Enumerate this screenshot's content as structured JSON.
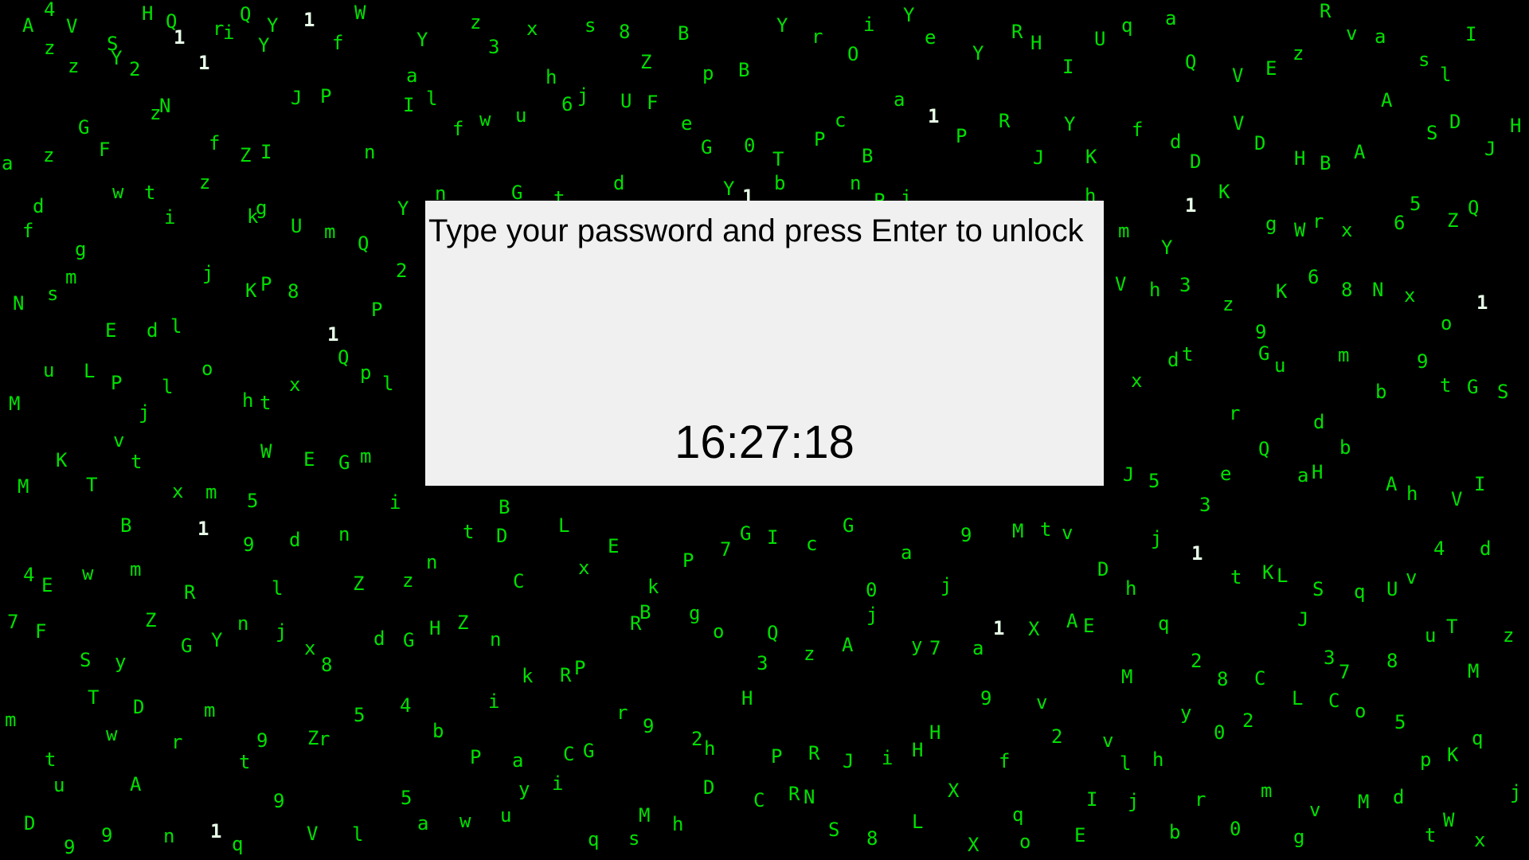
{
  "lock_screen": {
    "prompt": "Type your password and press Enter to unlock",
    "time": "16:27:18"
  },
  "matrix_rain": {
    "colors": {
      "background": "#000000",
      "glyph": "#00e000",
      "highlight": "#e8ffe8"
    },
    "glyphs": [
      "z",
      "V",
      "S",
      "2",
      "1",
      "1",
      "Q",
      "Y",
      "1",
      "f",
      "W",
      "a",
      "Y",
      "z",
      "3",
      "x",
      "h",
      "s",
      "8",
      "Z",
      "B",
      "p",
      "B",
      "Y",
      "r",
      "O",
      "i",
      "Y",
      "e",
      "Y",
      "R",
      "H",
      "I",
      "U",
      "q",
      "a",
      "Q",
      "V",
      "E",
      "z",
      "R",
      "v",
      "a",
      "s",
      "l",
      "I",
      "a",
      "z",
      "G",
      "F",
      "z",
      "N",
      "f",
      "Z",
      "I",
      "J",
      "P",
      "n",
      "I",
      "l",
      "f",
      "w",
      "u",
      "6",
      "j",
      "U",
      "F",
      "e",
      "G",
      "0",
      "T",
      "P",
      "c",
      "B",
      "a",
      "1",
      "P",
      "R",
      "J",
      "Y",
      "K",
      "f",
      "d",
      "D",
      "V",
      "D",
      "H",
      "B",
      "A",
      "A",
      "S",
      "D",
      "J",
      "H",
      "f",
      "d",
      "g",
      "w",
      "t",
      "i",
      "z",
      "k",
      "g",
      "U",
      "m",
      "Q",
      "Y",
      "n",
      "G",
      "t",
      "d",
      "Y",
      "1",
      "b",
      "n",
      "P",
      "i",
      "h",
      "m",
      "Y",
      "1",
      "K",
      "g",
      "W",
      "r",
      "x",
      "6",
      "5",
      "Z",
      "Q",
      "N",
      "s",
      "m",
      "E",
      "d",
      "l",
      "j",
      "K",
      "P",
      "8",
      "1",
      "P",
      "2",
      "V",
      "h",
      "3",
      "z",
      "9",
      "K",
      "6",
      "8",
      "N",
      "x",
      "o",
      "1",
      "M",
      "u",
      "L",
      "P",
      "j",
      "l",
      "o",
      "h",
      "t",
      "x",
      "Q",
      "p",
      "l",
      "x",
      "d",
      "t",
      "r",
      "G",
      "u",
      "d",
      "m",
      "b",
      "9",
      "t",
      "G",
      "S",
      "M",
      "K",
      "T",
      "v",
      "t",
      "x",
      "m",
      "5",
      "W",
      "E",
      "G",
      "m",
      "i",
      "B",
      "J",
      "5",
      "3",
      "e",
      "Q",
      "a",
      "H",
      "b",
      "A",
      "h",
      "V",
      "I",
      "4",
      "E",
      "w",
      "B",
      "m",
      "R",
      "1",
      "9",
      "l",
      "d",
      "n",
      "Z",
      "z",
      "n",
      "t",
      "D",
      "C",
      "L",
      "x",
      "E",
      "k",
      "P",
      "7",
      "G",
      "I",
      "c",
      "G",
      "0",
      "a",
      "j",
      "9",
      "M",
      "t",
      "v",
      "D",
      "h",
      "j",
      "1",
      "t",
      "K",
      "L",
      "S",
      "q",
      "U",
      "v",
      "4",
      "d",
      "7",
      "F",
      "S",
      "y",
      "Z",
      "G",
      "Y",
      "n",
      "j",
      "x",
      "8",
      "d",
      "G",
      "H",
      "Z",
      "n",
      "k",
      "R",
      "P",
      "R",
      "B",
      "g",
      "o",
      "3",
      "Q",
      "z",
      "A",
      "j",
      "y",
      "7",
      "a",
      "1",
      "X",
      "A",
      "E",
      "M",
      "q",
      "2",
      "8",
      "C",
      "J",
      "3",
      "7",
      "8",
      "u",
      "T",
      "M",
      "z",
      "m",
      "t",
      "T",
      "w",
      "D",
      "r",
      "m",
      "t",
      "9",
      "Z",
      "r",
      "5",
      "4",
      "b",
      "P",
      "i",
      "a",
      "C",
      "G",
      "r",
      "9",
      "2",
      "h",
      "H",
      "P",
      "R",
      "J",
      "i",
      "H",
      "H",
      "9",
      "f",
      "v",
      "2",
      "v",
      "l",
      "h",
      "y",
      "0",
      "2",
      "L",
      "C",
      "o",
      "5",
      "p",
      "K",
      "q",
      "D",
      "u",
      "9",
      "9",
      "A",
      "n",
      "1",
      "q",
      "9",
      "V",
      "l",
      "5",
      "a",
      "w",
      "u",
      "y",
      "i",
      "q",
      "s",
      "M",
      "h",
      "D",
      "C",
      "R",
      "N",
      "S",
      "8",
      "L",
      "X",
      "X",
      "q",
      "o",
      "E",
      "I",
      "j",
      "b",
      "r",
      "0",
      "m",
      "g",
      "v",
      "M",
      "d",
      "t",
      "W",
      "x",
      "j",
      "A",
      "4",
      "z",
      "Y",
      "H",
      "Q",
      "r",
      "i",
      "Y"
    ]
  }
}
